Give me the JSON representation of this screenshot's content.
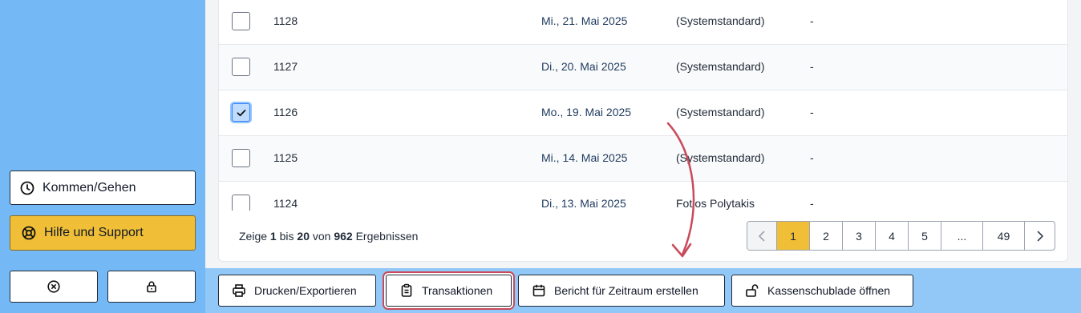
{
  "sidebar": {
    "kommen_label": "Kommen/Gehen",
    "hilfe_label": "Hilfe und Support"
  },
  "rows": [
    {
      "id": "1128",
      "date": "Mi., 21. Mai 2025",
      "user": "(Systemstandard)",
      "note": "-",
      "checked": false
    },
    {
      "id": "1127",
      "date": "Di., 20. Mai 2025",
      "user": "(Systemstandard)",
      "note": "-",
      "checked": false
    },
    {
      "id": "1126",
      "date": "Mo., 19. Mai 2025",
      "user": "(Systemstandard)",
      "note": "-",
      "checked": true
    },
    {
      "id": "1125",
      "date": "Mi., 14. Mai 2025",
      "user": "(Systemstandard)",
      "note": "-",
      "checked": false
    },
    {
      "id": "1124",
      "date": "Di., 13. Mai 2025",
      "user": "Fotios Polytakis",
      "note": "-",
      "checked": false
    }
  ],
  "pagination": {
    "prefix": "Zeige",
    "from": "1",
    "mid1": "bis",
    "to": "20",
    "mid2": "von",
    "total": "962",
    "suffix": "Ergebnissen",
    "pages": [
      "1",
      "2",
      "3",
      "4",
      "5",
      "...",
      "49"
    ],
    "active_page": "1"
  },
  "toolbar": {
    "druck_label": "Drucken/Exportieren",
    "trans_label": "Transaktionen",
    "bericht_label": "Bericht für Zeitraum erstellen",
    "kasse_label": "Kassenschublade öffnen"
  },
  "colors": {
    "sidebar_bg": "#74b9f5",
    "toolbar_bg": "#91c8f7",
    "accent": "#f0bf37",
    "highlight": "#c94a5a"
  }
}
